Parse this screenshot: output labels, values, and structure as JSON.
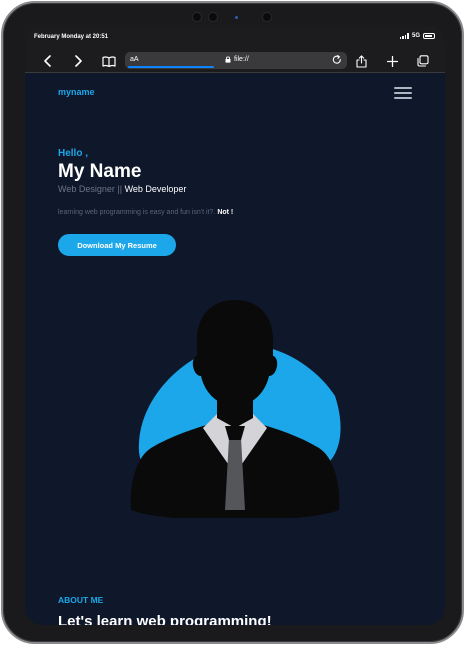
{
  "status_bar": {
    "time": "February Monday at 20:51",
    "network": "5G"
  },
  "browser": {
    "text_size_label": "aA",
    "url": "file://",
    "icons": {
      "back": "chevron-left-icon",
      "forward": "chevron-right-icon",
      "bookmarks": "book-icon",
      "lock": "lock-icon",
      "reload": "reload-icon",
      "share": "share-icon",
      "new_tab": "plus-icon",
      "tabs": "tabs-icon"
    }
  },
  "nav": {
    "brand": "myname",
    "menu_icon": "hamburger-menu-icon"
  },
  "hero": {
    "greeting": "Hello ,",
    "name": "My Name",
    "role_primary": "Web Designer",
    "role_separator": " || ",
    "role_secondary": "Web Developer",
    "tagline": "learning web programming is easy and fun isn't it?.",
    "tagline_emphasis": "Not !",
    "cta_label": "Download My Resume"
  },
  "about": {
    "label": "ABOUT ME",
    "heading": "Let's  learn web programming!"
  },
  "colors": {
    "accent": "#1ba7e9",
    "page_background": "#0f172a",
    "browser_chrome": "#1c1c1e"
  }
}
